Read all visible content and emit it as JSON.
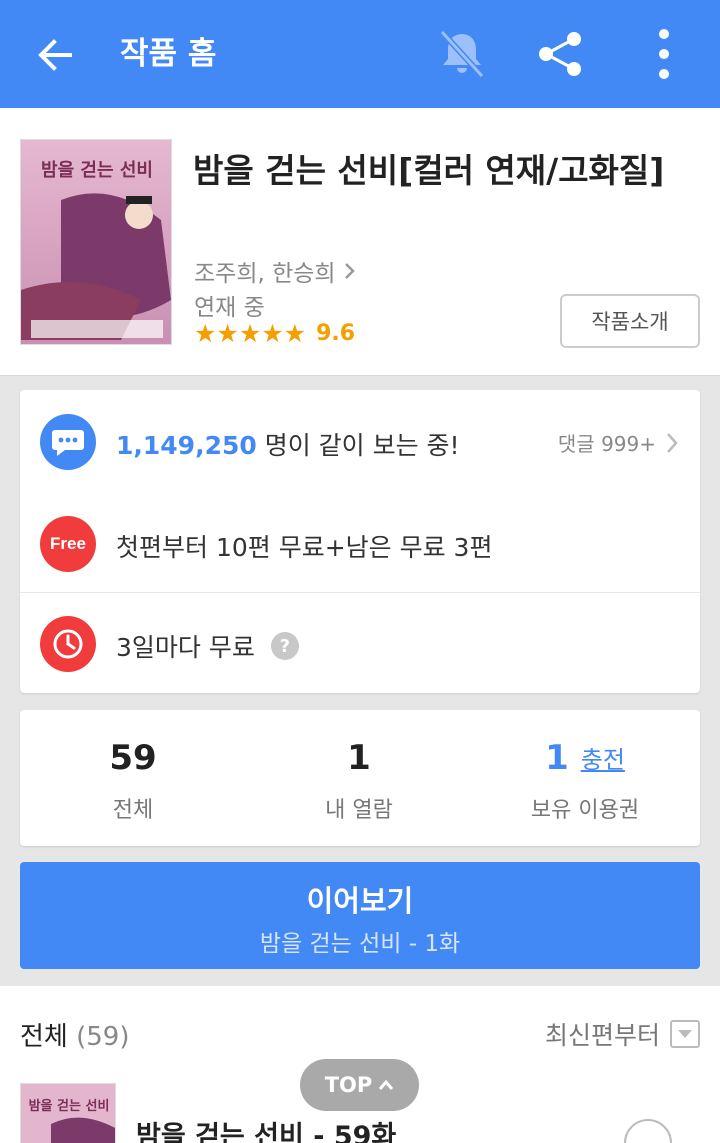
{
  "appbar": {
    "title": "작품 홈",
    "icons": [
      "back-arrow-icon",
      "bell-off-icon",
      "share-icon",
      "more-vert-icon"
    ],
    "color": "#4389f5"
  },
  "work": {
    "title": "밤을 걷는 선비[컬러 연재/고화질]",
    "authors": "조주희, 한승희",
    "status": "연재 중",
    "stars": "★★★★★",
    "rating": "9.6",
    "intro_button": "작품소개",
    "cover_title": "밤을 걷는 선비"
  },
  "notice": {
    "viewers_count": "1,149,250",
    "viewers_suffix": " 명이 같이 보는 중!",
    "comments": "댓글 999+",
    "free_badge": "Free",
    "free_text": "첫편부터 10편 무료+남은 무료 3편",
    "wait_text": "3일마다 무료",
    "help_mark": "?"
  },
  "stats": {
    "total": {
      "value": "59",
      "label": "전체"
    },
    "viewed": {
      "value": "1",
      "label": "내 열람"
    },
    "tickets": {
      "value": "1",
      "charge": "충전",
      "label": "보유 이용권"
    }
  },
  "cta": {
    "main": "이어보기",
    "sub": "밤을 걷는 선비 - 1화"
  },
  "episodes": {
    "header": "전체",
    "count": "(59)",
    "sort": "최신편부터",
    "items": [
      {
        "title": "밤을 걷는 선비 - 59화"
      }
    ]
  },
  "top_button": "TOP",
  "colors": {
    "accent": "#4389f5",
    "red": "#f03c3c",
    "star": "#f49e00"
  }
}
